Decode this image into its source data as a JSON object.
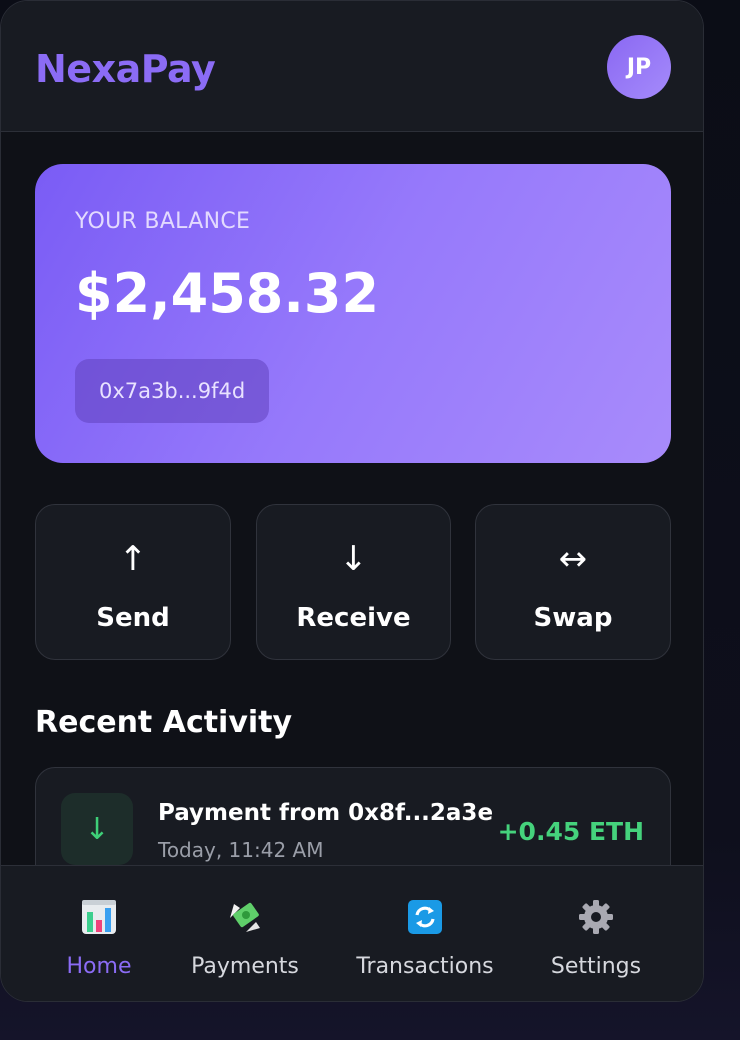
{
  "app": {
    "brand": "NexaPay",
    "avatar_initials": "JP"
  },
  "balance": {
    "label": "YOUR BALANCE",
    "amount": "$2,458.32",
    "address": "0x7a3b...9f4d"
  },
  "actions": [
    {
      "glyph": "↑",
      "label": "Send",
      "icon": "arrow-up-icon"
    },
    {
      "glyph": "↓",
      "label": "Receive",
      "icon": "arrow-down-icon"
    },
    {
      "glyph": "↔",
      "label": "Swap",
      "icon": "swap-arrows-icon"
    }
  ],
  "activity": {
    "title": "Recent Activity",
    "items": [
      {
        "glyph": "↓",
        "title": "Payment from 0x8f...2a3e",
        "time": "Today, 11:42 AM",
        "amount": "+0.45 ETH",
        "amount_color": "#45d27c"
      }
    ]
  },
  "nav": {
    "items": [
      {
        "label": "Home",
        "icon": "bar-chart-icon",
        "active": true
      },
      {
        "label": "Payments",
        "icon": "money-wings-icon",
        "active": false
      },
      {
        "label": "Transactions",
        "icon": "refresh-arrows-icon",
        "active": false
      },
      {
        "label": "Settings",
        "icon": "gear-icon",
        "active": false
      }
    ]
  },
  "colors": {
    "accent": "#8b6cf5",
    "background": "#0f1117",
    "surface": "#181b22",
    "positive": "#45d27c"
  }
}
